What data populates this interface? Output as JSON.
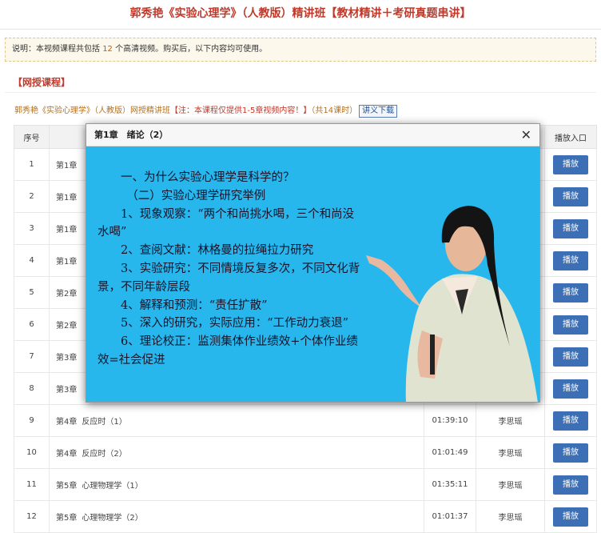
{
  "page_title": "郭秀艳《实验心理学》（人教版）精讲班【教材精讲＋考研真题串讲】",
  "notice": {
    "prefix": "说明：本视频课程共包括",
    "count": "12",
    "suffix": "个高清视频。购买后，以下内容均可使用。"
  },
  "section_title": "【网授课程】",
  "course": {
    "name": "郭秀艳《实验心理学》（人教版）网授精讲班",
    "warning": "【注：本课程仅提供1-5章视频内容！】",
    "hours": "（共14课时）",
    "download_label": "讲义下载"
  },
  "table": {
    "headers": {
      "num": "序号",
      "title": "",
      "duration": "",
      "teacher": "",
      "play": "播放入口"
    },
    "rows": [
      {
        "num": "1",
        "chapter": "第1章",
        "title": "",
        "duration": "",
        "teacher": "",
        "play": "播放"
      },
      {
        "num": "2",
        "chapter": "第1章",
        "title": "",
        "duration": "",
        "teacher": "",
        "play": "播放"
      },
      {
        "num": "3",
        "chapter": "第1章",
        "title": "",
        "duration": "",
        "teacher": "",
        "play": "播放"
      },
      {
        "num": "4",
        "chapter": "第1章",
        "title": "",
        "duration": "",
        "teacher": "",
        "play": "播放"
      },
      {
        "num": "5",
        "chapter": "第2章",
        "title": "",
        "duration": "",
        "teacher": "",
        "play": "播放"
      },
      {
        "num": "6",
        "chapter": "第2章",
        "title": "",
        "duration": "",
        "teacher": "",
        "play": "播放"
      },
      {
        "num": "7",
        "chapter": "第3章",
        "title": "",
        "duration": "",
        "teacher": "",
        "play": "播放"
      },
      {
        "num": "8",
        "chapter": "第3章",
        "title": "",
        "duration": "",
        "teacher": "",
        "play": "播放"
      },
      {
        "num": "9",
        "chapter": "第4章",
        "title": "反应时（1）",
        "duration": "01:39:10",
        "teacher": "李思瑶",
        "play": "播放"
      },
      {
        "num": "10",
        "chapter": "第4章",
        "title": "反应时（2）",
        "duration": "01:01:49",
        "teacher": "李思瑶",
        "play": "播放"
      },
      {
        "num": "11",
        "chapter": "第5章",
        "title": "心理物理学（1）",
        "duration": "01:35:11",
        "teacher": "李思瑶",
        "play": "播放"
      },
      {
        "num": "12",
        "chapter": "第5章",
        "title": "心理物理学（2）",
        "duration": "01:01:37",
        "teacher": "李思瑶",
        "play": "播放"
      }
    ]
  },
  "modal": {
    "title": "第1章　绪论（2）",
    "close_icon": "close-icon",
    "slide_lines": [
      "　　一、为什么实验心理学是科学的？",
      "　　　（二）实验心理学研究举例",
      "　　1、现象观察：“两个和尚挑水喝，三个和尚没",
      "水喝”",
      "　　2、查阅文献：林格曼的拉绳拉力研究",
      "　　3、实验研究：不同情境反复多次，不同文化背",
      "景，不同年龄层段",
      "　　4、解释和预测：“责任扩散”",
      "　　5、深入的研究，实际应用：“工作动力衰退”",
      "　　6、理论校正：监测集体作业绩效+个体作业绩",
      "效=社会促进"
    ]
  },
  "colors": {
    "title_red": "#c0392b",
    "play_blue": "#3c6fb5",
    "video_bg": "#27b7ec"
  }
}
